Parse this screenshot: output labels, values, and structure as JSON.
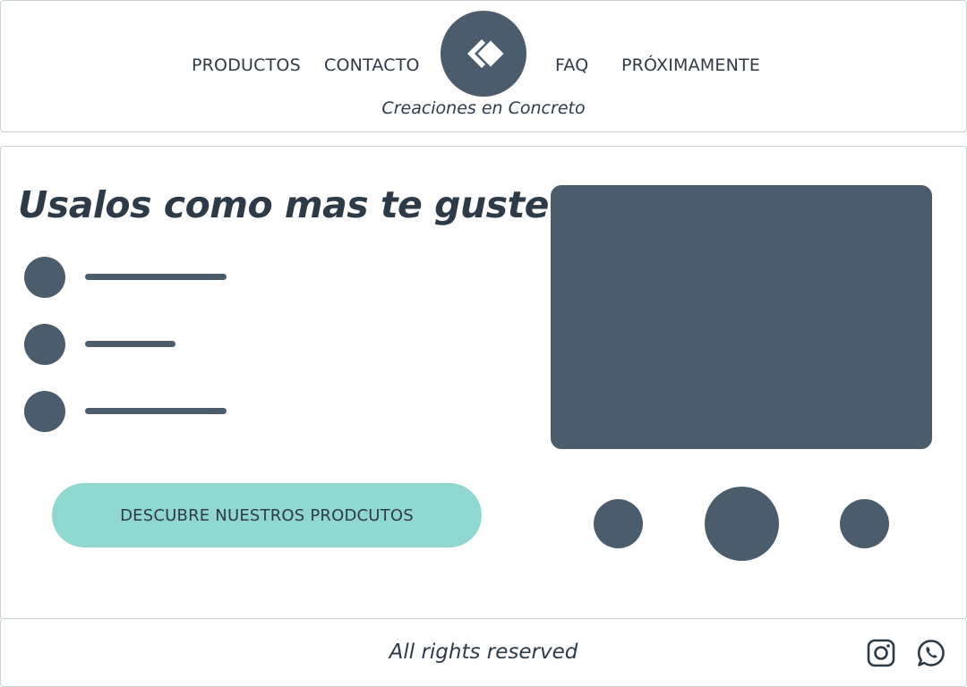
{
  "header": {
    "nav_left": [
      "PRODUCTOS",
      "CONTACTO"
    ],
    "nav_right": [
      "FAQ",
      "PRÓXIMAMENTE"
    ],
    "logo_icon": "diamond-logo-icon",
    "brand": "Creaciones en Concreto"
  },
  "main": {
    "headline": "Usalos como mas te guste!",
    "cta_label": "DESCUBRE NUESTROS PRODCUTOS",
    "bullets_count": 3
  },
  "footer": {
    "text": "All rights reserved",
    "social_icons": [
      "instagram-icon",
      "whatsapp-icon"
    ]
  },
  "colors": {
    "primary": "#4b5d6c",
    "text": "#2d3b48",
    "accent": "#90d8cf",
    "border": "#c9d3da"
  }
}
